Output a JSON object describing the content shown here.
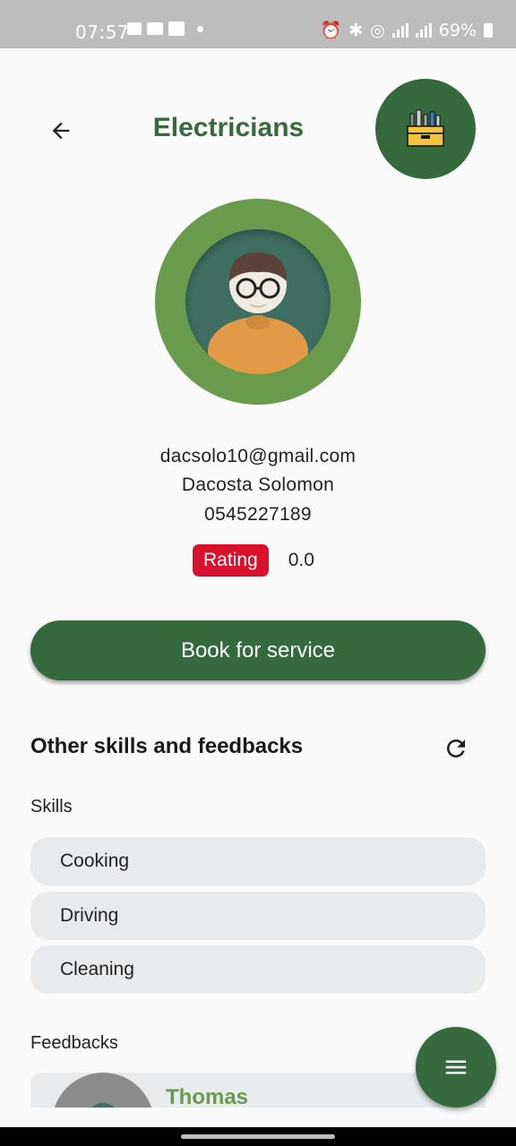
{
  "status_bar": {
    "time": "07:57",
    "battery": "69%"
  },
  "header": {
    "title": "Electricians"
  },
  "profile": {
    "email": "dacsolo10@gmail.com",
    "name": "Dacosta Solomon",
    "phone": "0545227189",
    "rating_label": "Rating",
    "rating_value": "0.0"
  },
  "actions": {
    "book_label": "Book for service"
  },
  "skills_section": {
    "title": "Other skills and feedbacks",
    "skills_label": "Skills",
    "skills": [
      "Cooking",
      "Driving",
      "Cleaning"
    ],
    "feedbacks_label": "Feedbacks",
    "feedbacks": [
      {
        "name": "Thomas"
      }
    ]
  },
  "colors": {
    "primary": "#356b3c",
    "accent": "#6a9a4b",
    "rating_badge": "#d7112e",
    "chip_bg": "#e7ebee"
  },
  "icons": {
    "back": "arrow-left-icon",
    "toolbox": "toolbox-icon",
    "refresh": "refresh-icon",
    "menu": "hamburger-menu-icon"
  }
}
